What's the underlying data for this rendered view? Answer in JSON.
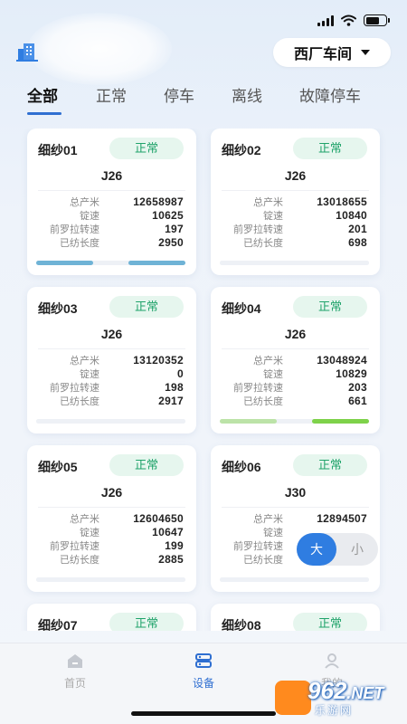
{
  "header": {
    "workshop": "西厂车间"
  },
  "tabs": [
    "全部",
    "正常",
    "停车",
    "离线",
    "故障停车"
  ],
  "labels": {
    "total_output": "总产米",
    "spindle_speed": "锭速",
    "front_roller_speed": "前罗拉转速",
    "spun_length": "已纺长度"
  },
  "cards": [
    {
      "name": "细纱01",
      "status": "正常",
      "model": "J26",
      "total_output": "12658987",
      "spindle_speed": "10625",
      "front_roller_speed": "197",
      "spun_length": "2950",
      "progress_color": "#6fb3d6"
    },
    {
      "name": "细纱02",
      "status": "正常",
      "model": "J26",
      "total_output": "13018655",
      "spindle_speed": "10840",
      "front_roller_speed": "201",
      "spun_length": "698",
      "progress_color": "#eef1f6"
    },
    {
      "name": "细纱03",
      "status": "正常",
      "model": "J26",
      "total_output": "13120352",
      "spindle_speed": "0",
      "front_roller_speed": "198",
      "spun_length": "2917",
      "progress_color": "#eef1f6"
    },
    {
      "name": "细纱04",
      "status": "正常",
      "model": "J26",
      "total_output": "13048924",
      "spindle_speed": "10829",
      "front_roller_speed": "203",
      "spun_length": "661",
      "progress_color": "#7ed24a"
    },
    {
      "name": "细纱05",
      "status": "正常",
      "model": "J26",
      "total_output": "12604650",
      "spindle_speed": "10647",
      "front_roller_speed": "199",
      "spun_length": "2885",
      "progress_color": "#eef1f6"
    },
    {
      "name": "细纱06",
      "status": "正常",
      "model": "J30",
      "total_output": "12894507",
      "spindle_speed": "",
      "front_roller_speed": "",
      "spun_length": "",
      "progress_color": "#eef1f6"
    },
    {
      "name": "细纱07",
      "status": "正常"
    },
    {
      "name": "细纱08",
      "status": "正常"
    }
  ],
  "size_toggle": {
    "big": "大",
    "small": "小"
  },
  "bottom_nav": [
    {
      "label": "首页",
      "icon": "home-icon",
      "active": false
    },
    {
      "label": "设备",
      "icon": "device-icon",
      "active": true
    },
    {
      "label": "我的",
      "icon": "profile-icon",
      "active": false
    }
  ],
  "watermark": {
    "brand": "962",
    "suffix": ".NET",
    "subtitle": "乐游网"
  },
  "colors": {
    "accent": "#2f6fd1",
    "status_normal": "#1fa36a",
    "status_bg": "#e6f6ee",
    "size_big_bg": "#2f7de1"
  }
}
